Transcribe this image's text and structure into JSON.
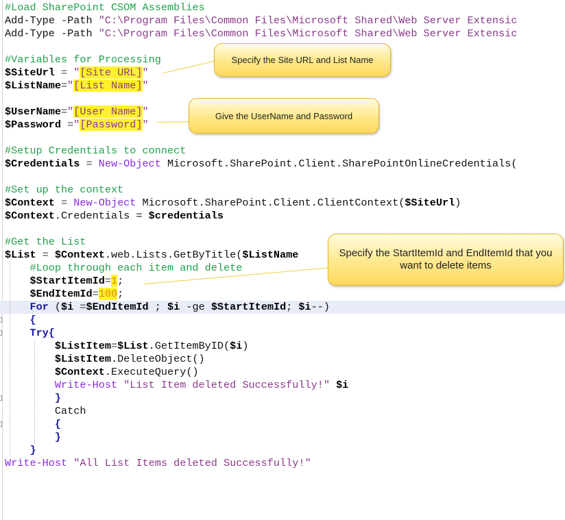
{
  "code_lines": [
    {
      "tokens": [
        {
          "t": "#Load SharePoint CSOM Assemblies",
          "c": "comment"
        }
      ]
    },
    {
      "tokens": [
        {
          "t": "Add-Type -Path ",
          "c": "text"
        },
        {
          "t": "\"C:\\Program Files\\Common Files\\Microsoft Shared\\Web Server Extensic",
          "c": "string"
        }
      ]
    },
    {
      "tokens": [
        {
          "t": "Add-Type -Path ",
          "c": "text"
        },
        {
          "t": "\"C:\\Program Files\\Common Files\\Microsoft Shared\\Web Server Extensic",
          "c": "string"
        }
      ]
    },
    {
      "tokens": []
    },
    {
      "tokens": [
        {
          "t": "#Variables for Processing",
          "c": "comment"
        }
      ]
    },
    {
      "tokens": [
        {
          "t": "$SiteUrl",
          "c": "var"
        },
        {
          "t": " = ",
          "c": "op"
        },
        {
          "t": "\"",
          "c": "string"
        },
        {
          "t": "[Site URL]",
          "c": "string",
          "hl": true
        },
        {
          "t": "\"",
          "c": "string"
        }
      ]
    },
    {
      "tokens": [
        {
          "t": "$ListName",
          "c": "var"
        },
        {
          "t": "=",
          "c": "op"
        },
        {
          "t": "\"",
          "c": "string"
        },
        {
          "t": "[List Name]",
          "c": "string",
          "hl": true
        },
        {
          "t": "\"",
          "c": "string"
        }
      ]
    },
    {
      "tokens": []
    },
    {
      "tokens": [
        {
          "t": "$UserName",
          "c": "var"
        },
        {
          "t": "=",
          "c": "op"
        },
        {
          "t": "\"",
          "c": "string"
        },
        {
          "t": "[User Name]",
          "c": "string",
          "hl": true
        },
        {
          "t": "\"",
          "c": "string"
        }
      ]
    },
    {
      "tokens": [
        {
          "t": "$Password",
          "c": "var"
        },
        {
          "t": " =",
          "c": "op"
        },
        {
          "t": "\"",
          "c": "string"
        },
        {
          "t": "[Password]",
          "c": "string",
          "hl": true
        },
        {
          "t": "\"",
          "c": "string"
        }
      ]
    },
    {
      "tokens": []
    },
    {
      "tokens": [
        {
          "t": "#Setup Credentials to connect",
          "c": "comment"
        }
      ]
    },
    {
      "tokens": [
        {
          "t": "$Credentials",
          "c": "var"
        },
        {
          "t": " = ",
          "c": "op"
        },
        {
          "t": "New-Object",
          "c": "cmd"
        },
        {
          "t": " Microsoft.SharePoint.Client.SharePointOnlineCredentials(",
          "c": "text"
        }
      ]
    },
    {
      "tokens": []
    },
    {
      "tokens": [
        {
          "t": "#Set up the context",
          "c": "comment"
        }
      ]
    },
    {
      "tokens": [
        {
          "t": "$Context",
          "c": "var"
        },
        {
          "t": " = ",
          "c": "op"
        },
        {
          "t": "New-Object",
          "c": "cmd"
        },
        {
          "t": " Microsoft.SharePoint.Client.ClientContext(",
          "c": "text"
        },
        {
          "t": "$SiteUrl",
          "c": "var"
        },
        {
          "t": ")",
          "c": "text"
        }
      ]
    },
    {
      "tokens": [
        {
          "t": "$Context",
          "c": "var"
        },
        {
          "t": ".Credentials = ",
          "c": "text"
        },
        {
          "t": "$credentials",
          "c": "var"
        }
      ]
    },
    {
      "tokens": []
    },
    {
      "tokens": [
        {
          "t": "#Get the List",
          "c": "comment"
        }
      ]
    },
    {
      "tokens": [
        {
          "t": "$List",
          "c": "var"
        },
        {
          "t": " = ",
          "c": "op"
        },
        {
          "t": "$Context",
          "c": "var"
        },
        {
          "t": ".web.Lists.GetByTitle(",
          "c": "text"
        },
        {
          "t": "$ListName",
          "c": "var"
        }
      ]
    },
    {
      "tokens": [
        {
          "t": "    ",
          "c": "text"
        },
        {
          "t": "#Loop through each item and delete",
          "c": "comment"
        }
      ],
      "guides": [
        1
      ]
    },
    {
      "tokens": [
        {
          "t": "    ",
          "c": "text"
        },
        {
          "t": "$StartItemId",
          "c": "var"
        },
        {
          "t": "=",
          "c": "op"
        },
        {
          "t": "1",
          "c": "num",
          "hl": true
        },
        {
          "t": ";",
          "c": "text"
        }
      ],
      "guides": [
        1
      ]
    },
    {
      "tokens": [
        {
          "t": "    ",
          "c": "text"
        },
        {
          "t": "$EndItemId",
          "c": "var"
        },
        {
          "t": "=",
          "c": "op"
        },
        {
          "t": "100",
          "c": "num",
          "hl": true
        },
        {
          "t": ";",
          "c": "text"
        }
      ],
      "guides": [
        1
      ]
    },
    {
      "tokens": [
        {
          "t": "    ",
          "c": "text"
        },
        {
          "t": "For",
          "c": "kw"
        },
        {
          "t": " (",
          "c": "text"
        },
        {
          "t": "$i",
          "c": "var"
        },
        {
          "t": " =",
          "c": "op"
        },
        {
          "t": "$EndItemId",
          "c": "var"
        },
        {
          "t": " ; ",
          "c": "text"
        },
        {
          "t": "$i",
          "c": "var"
        },
        {
          "t": " -ge ",
          "c": "text"
        },
        {
          "t": "$StartItemId",
          "c": "var"
        },
        {
          "t": "; ",
          "c": "text"
        },
        {
          "t": "$i",
          "c": "var"
        },
        {
          "t": "--)",
          "c": "text"
        }
      ],
      "current": true,
      "guides": [
        1
      ]
    },
    {
      "tokens": [
        {
          "t": "    ",
          "c": "text"
        },
        {
          "t": "{",
          "c": "kw"
        }
      ],
      "fold": true,
      "guides": [
        1
      ]
    },
    {
      "tokens": [
        {
          "t": "    ",
          "c": "text"
        },
        {
          "t": "Try{",
          "c": "kw"
        }
      ],
      "fold": true,
      "guides": [
        1
      ]
    },
    {
      "tokens": [
        {
          "t": "        ",
          "c": "text"
        },
        {
          "t": "$ListItem",
          "c": "var"
        },
        {
          "t": "=",
          "c": "op"
        },
        {
          "t": "$List",
          "c": "var"
        },
        {
          "t": ".GetItemByID(",
          "c": "text"
        },
        {
          "t": "$i",
          "c": "var"
        },
        {
          "t": ")",
          "c": "text"
        }
      ],
      "guides": [
        1,
        2
      ]
    },
    {
      "tokens": [
        {
          "t": "        ",
          "c": "text"
        },
        {
          "t": "$ListItem",
          "c": "var"
        },
        {
          "t": ".DeleteObject()",
          "c": "text"
        }
      ],
      "guides": [
        1,
        2
      ]
    },
    {
      "tokens": [
        {
          "t": "        ",
          "c": "text"
        },
        {
          "t": "$Context",
          "c": "var"
        },
        {
          "t": ".ExecuteQuery()",
          "c": "text"
        }
      ],
      "guides": [
        1,
        2
      ]
    },
    {
      "tokens": [
        {
          "t": "        ",
          "c": "text"
        },
        {
          "t": "Write-Host",
          "c": "cmd"
        },
        {
          "t": " \"List Item deleted Successfully!\" ",
          "c": "string"
        },
        {
          "t": "$i",
          "c": "var"
        }
      ],
      "guides": [
        1,
        2
      ]
    },
    {
      "tokens": [
        {
          "t": "        ",
          "c": "text"
        },
        {
          "t": "}",
          "c": "kw"
        }
      ],
      "fold": true,
      "guides": [
        1,
        2
      ]
    },
    {
      "tokens": [
        {
          "t": "        ",
          "c": "text"
        },
        {
          "t": "Catch",
          "c": "text"
        }
      ],
      "guides": [
        1,
        2
      ]
    },
    {
      "tokens": [
        {
          "t": "        ",
          "c": "text"
        },
        {
          "t": "{",
          "c": "kw"
        }
      ],
      "fold": true,
      "guides": [
        1,
        2
      ]
    },
    {
      "tokens": [
        {
          "t": "        ",
          "c": "text"
        },
        {
          "t": "}",
          "c": "kw"
        }
      ],
      "guides": [
        1,
        2
      ]
    },
    {
      "tokens": [
        {
          "t": "    ",
          "c": "text"
        },
        {
          "t": "}",
          "c": "kw"
        }
      ],
      "guides": [
        1
      ]
    },
    {
      "tokens": [
        {
          "t": "Write-Host",
          "c": "cmd"
        },
        {
          "t": " \"All List Items deleted Successfully!\"",
          "c": "string"
        }
      ]
    }
  ],
  "callouts": {
    "site": "Specify the Site URL and List Name",
    "credentials": "Give the UserName and Password",
    "items": "Specify the StartItemId and EndItemId that you want to delete items"
  },
  "colors": {
    "comment": "#22a14b",
    "string": "#8b3a8b",
    "cmdlet": "#8a2be2",
    "keyword": "#1a1aa6",
    "number": "#e08a00",
    "highlight": "#fff12e",
    "current_line": "#e8ecf6",
    "callout_fill": "#ffe88a",
    "callout_border": "#e5b52a"
  }
}
